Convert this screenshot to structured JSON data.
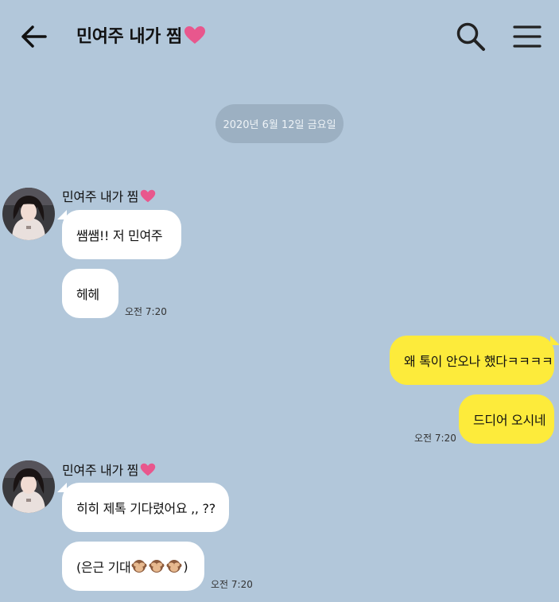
{
  "header": {
    "title": "민여주 내가 찜",
    "back_icon": "arrow-left-icon",
    "search_icon": "search-icon",
    "menu_icon": "hamburger-menu-icon",
    "heart_icon": "heart-icon",
    "heart_color": "#e8578d"
  },
  "date_divider": "2020년 6월 12일 금요일",
  "messages": {
    "group1": {
      "sender": "민여주 내가 찜",
      "bubble1": "쌤쌤!! 저 민여주",
      "bubble2": "헤헤",
      "time": "오전 7:20"
    },
    "group2": {
      "bubble1": "왜 톡이 안오나 했다ㅋㅋㅋㅋ",
      "bubble2": "드디어 오시네",
      "time": "오전 7:20"
    },
    "group3": {
      "sender": "민여주 내가 찜",
      "bubble1": "히히 제톡 기다렸어요 ,, ??",
      "bubble2_prefix": "(은근 기대",
      "bubble2_suffix": ")",
      "bubble2_emoji": "see-no-evil-monkey-icon",
      "time": "오전 7:20"
    }
  },
  "colors": {
    "background": "#b2c7da",
    "incoming_bubble": "#ffffff",
    "outgoing_bubble": "#fdeb3b",
    "date_pill": "#9cb0c2"
  }
}
